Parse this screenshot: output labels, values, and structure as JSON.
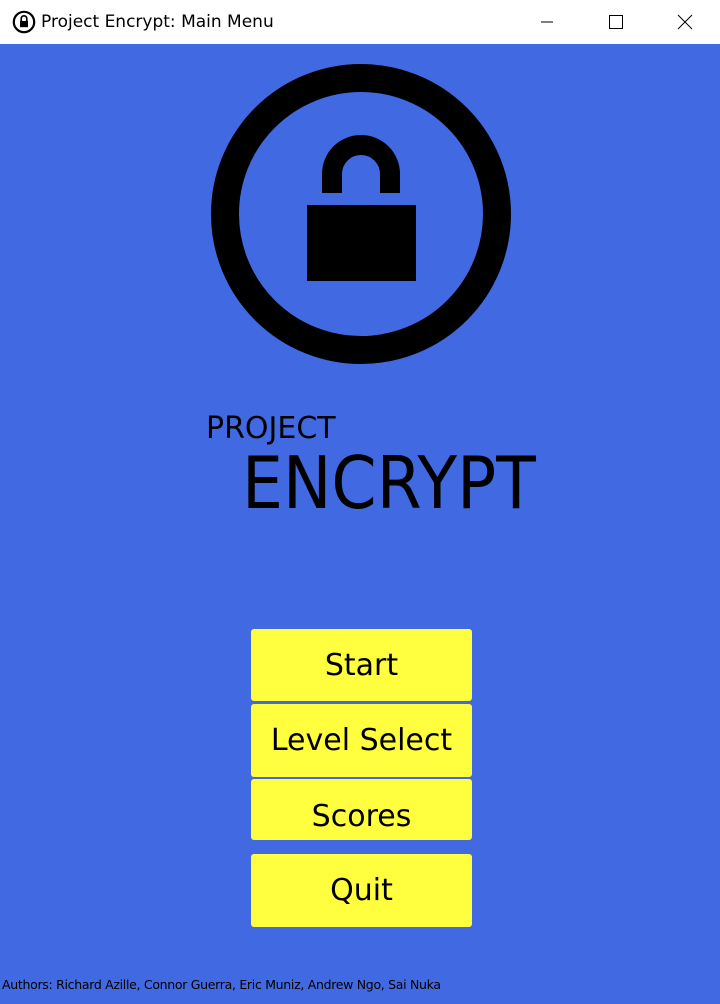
{
  "window": {
    "title": "Project Encrypt: Main Menu",
    "icon": "padlock-icon",
    "controls": [
      "minimize-icon",
      "maximize-icon",
      "close-icon"
    ]
  },
  "logo": {
    "icon": "padlock-circle-icon"
  },
  "heading": {
    "line1": "PROJECT",
    "line2": "ENCRYPT"
  },
  "menu": {
    "start_label": "Start",
    "level_select_label": "Level Select",
    "scores_label": "Scores",
    "quit_label": "Quit"
  },
  "footer": {
    "authors": "Authors: Richard Azille, Connor Guerra, Eric Muniz, Andrew Ngo, Sai Nuka"
  },
  "colors": {
    "background": "#4169e1",
    "button": "#ffff3f",
    "text": "#000000"
  }
}
